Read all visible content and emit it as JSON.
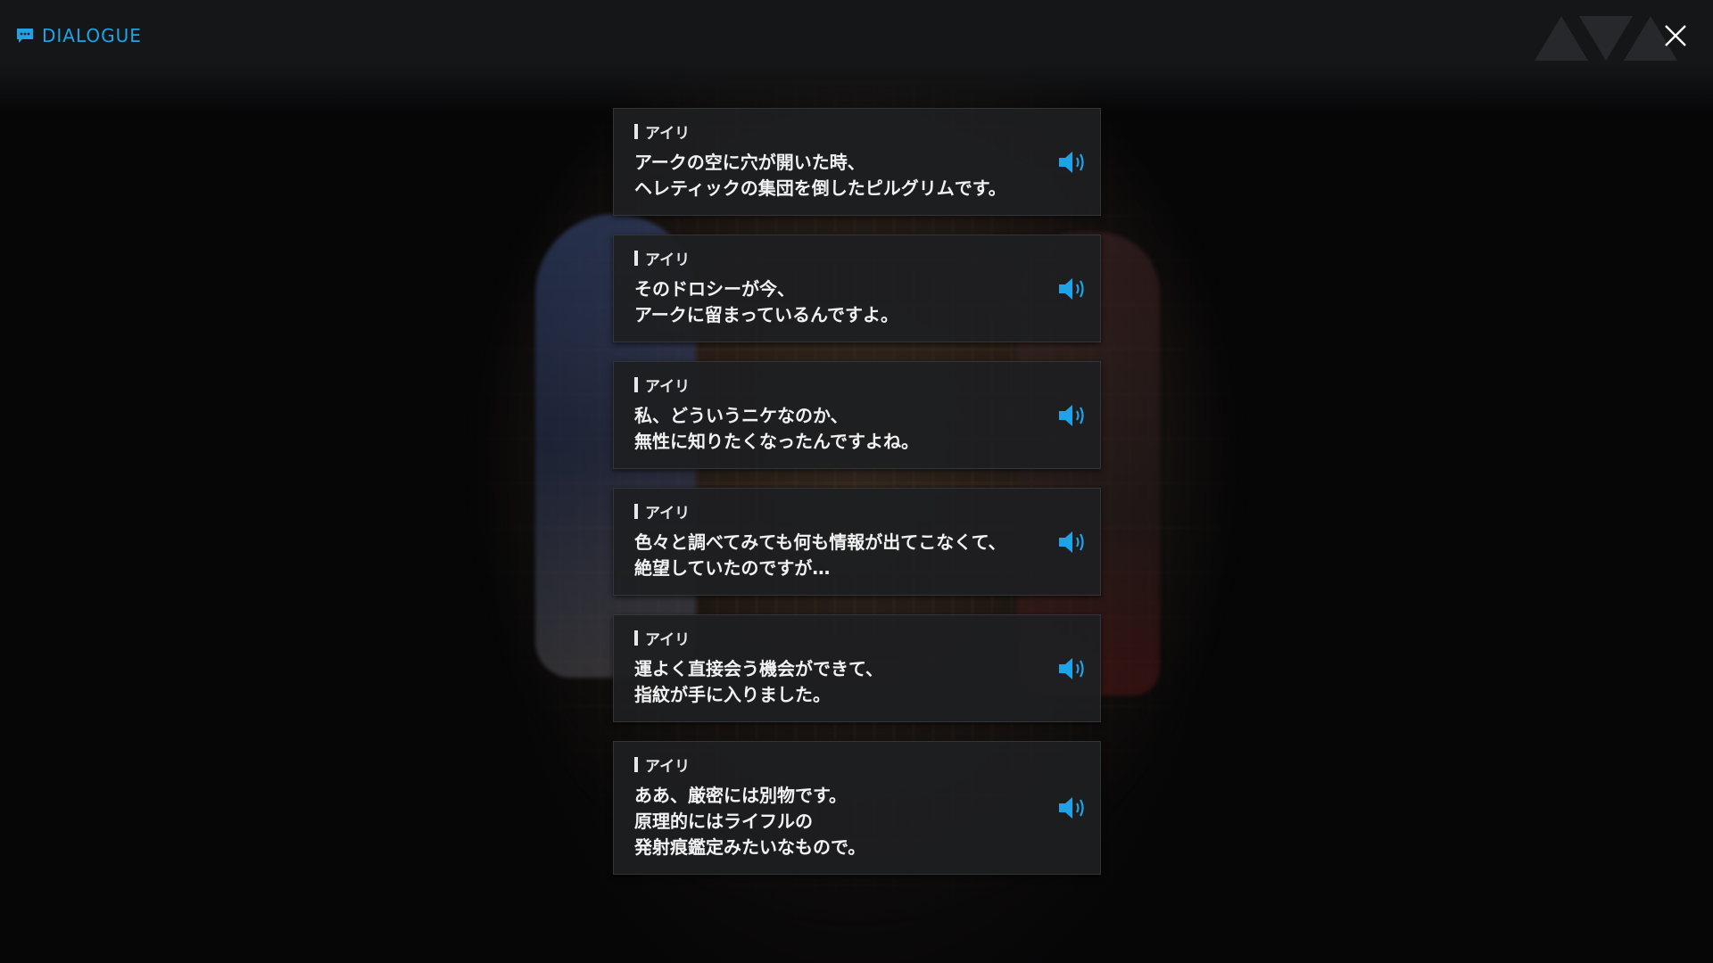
{
  "header": {
    "title": "DIALOGUE",
    "icon": "chat-bubble-icon",
    "accent_color": "#1fa3e8"
  },
  "close": {
    "icon": "close-icon"
  },
  "dialogues": [
    {
      "speaker": "アイリ",
      "text": "アークの空に穴が開いた時、\nヘレティックの集団を倒したピルグリムです。",
      "voice_icon": "speaker-icon"
    },
    {
      "speaker": "アイリ",
      "text": "そのドロシーが今、\nアークに留まっているんですよ。",
      "voice_icon": "speaker-icon"
    },
    {
      "speaker": "アイリ",
      "text": "私、どういうニケなのか、\n無性に知りたくなったんですよね。",
      "voice_icon": "speaker-icon"
    },
    {
      "speaker": "アイリ",
      "text": "色々と調べてみても何も情報が出てこなくて、\n絶望していたのですが…",
      "voice_icon": "speaker-icon"
    },
    {
      "speaker": "アイリ",
      "text": "運よく直接会う機会ができて、\n指紋が手に入りました。",
      "voice_icon": "speaker-icon"
    },
    {
      "speaker": "アイリ",
      "text": "ああ、厳密には別物です。\n原理的にはライフルの\n発射痕鑑定みたいなもので。",
      "voice_icon": "speaker-icon"
    }
  ]
}
